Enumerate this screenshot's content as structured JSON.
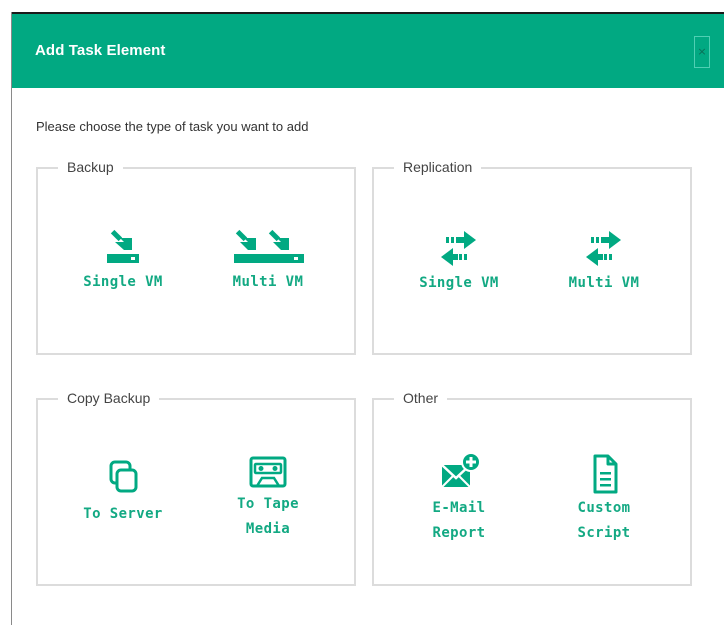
{
  "dialog": {
    "title": "Add Task Element",
    "close_glyph": "×",
    "prompt": "Please choose the type of task you want to add"
  },
  "colors": {
    "accent": "#01a982",
    "header_text": "#ffffff",
    "label": "#13a983",
    "border": "#dcdcdc"
  },
  "groups": [
    {
      "legend": "Backup",
      "options": [
        {
          "line1": "Single VM",
          "line2": "",
          "icon": "single-vm-backup-icon"
        },
        {
          "line1": "Multi VM",
          "line2": "",
          "icon": "multi-vm-backup-icon"
        }
      ]
    },
    {
      "legend": "Replication",
      "options": [
        {
          "line1": "Single VM",
          "line2": "",
          "icon": "single-vm-replication-icon"
        },
        {
          "line1": "Multi VM",
          "line2": "",
          "icon": "multi-vm-replication-icon"
        }
      ]
    },
    {
      "legend": "Copy Backup",
      "options": [
        {
          "line1": "To Server",
          "line2": "",
          "icon": "copy-icon"
        },
        {
          "line1": "To Tape",
          "line2": "Media",
          "icon": "tape-icon"
        }
      ]
    },
    {
      "legend": "Other",
      "options": [
        {
          "line1": "E-Mail",
          "line2": "Report",
          "icon": "email-add-icon"
        },
        {
          "line1": "Custom",
          "line2": "Script",
          "icon": "script-icon"
        }
      ]
    }
  ]
}
